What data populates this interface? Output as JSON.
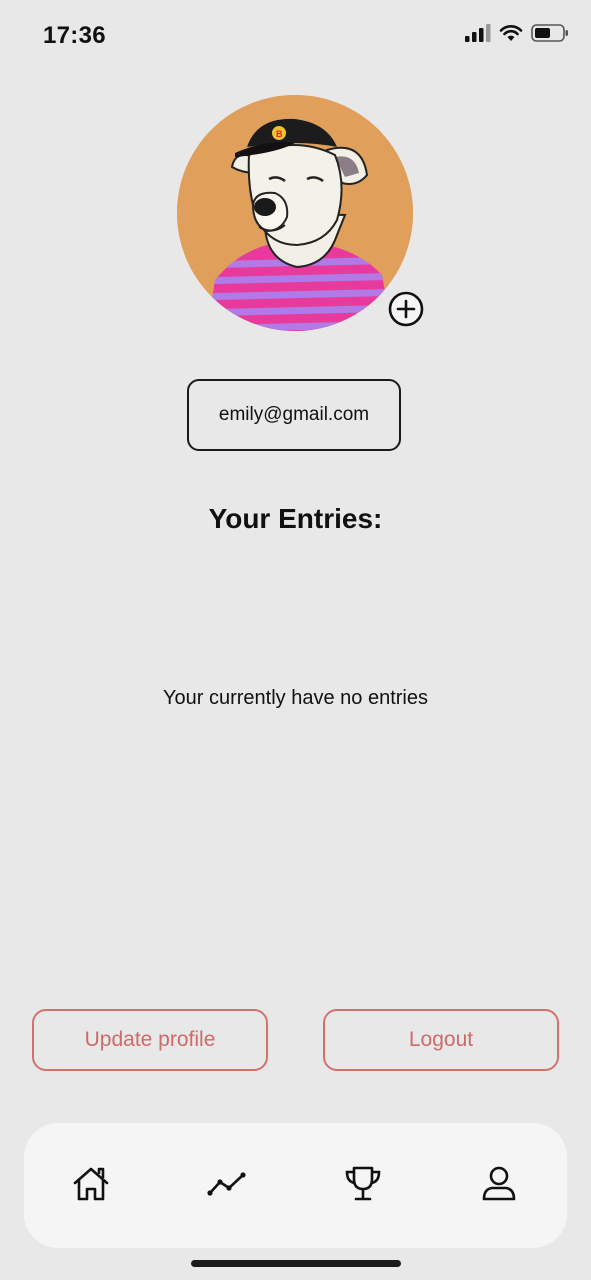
{
  "status_bar": {
    "time": "17:36",
    "icons": [
      "signal-icon",
      "wifi-icon",
      "battery-icon"
    ]
  },
  "profile": {
    "avatar": "dog-avatar-image",
    "add_icon": "plus-circle-icon",
    "email": "emily@gmail.com"
  },
  "entries": {
    "title": "Your Entries:",
    "empty_message": "Your currently have no entries"
  },
  "actions": {
    "update_label": "Update profile",
    "logout_label": "Logout"
  },
  "tab_bar": {
    "items": [
      {
        "icon": "home-icon"
      },
      {
        "icon": "chart-line-icon"
      },
      {
        "icon": "trophy-icon"
      },
      {
        "icon": "user-icon"
      }
    ]
  },
  "colors": {
    "background": "#e9e8e9",
    "accent": "#cc6b67",
    "avatar_bg": "#e0a05c",
    "tab_bar_bg": "#f5f5f5"
  }
}
